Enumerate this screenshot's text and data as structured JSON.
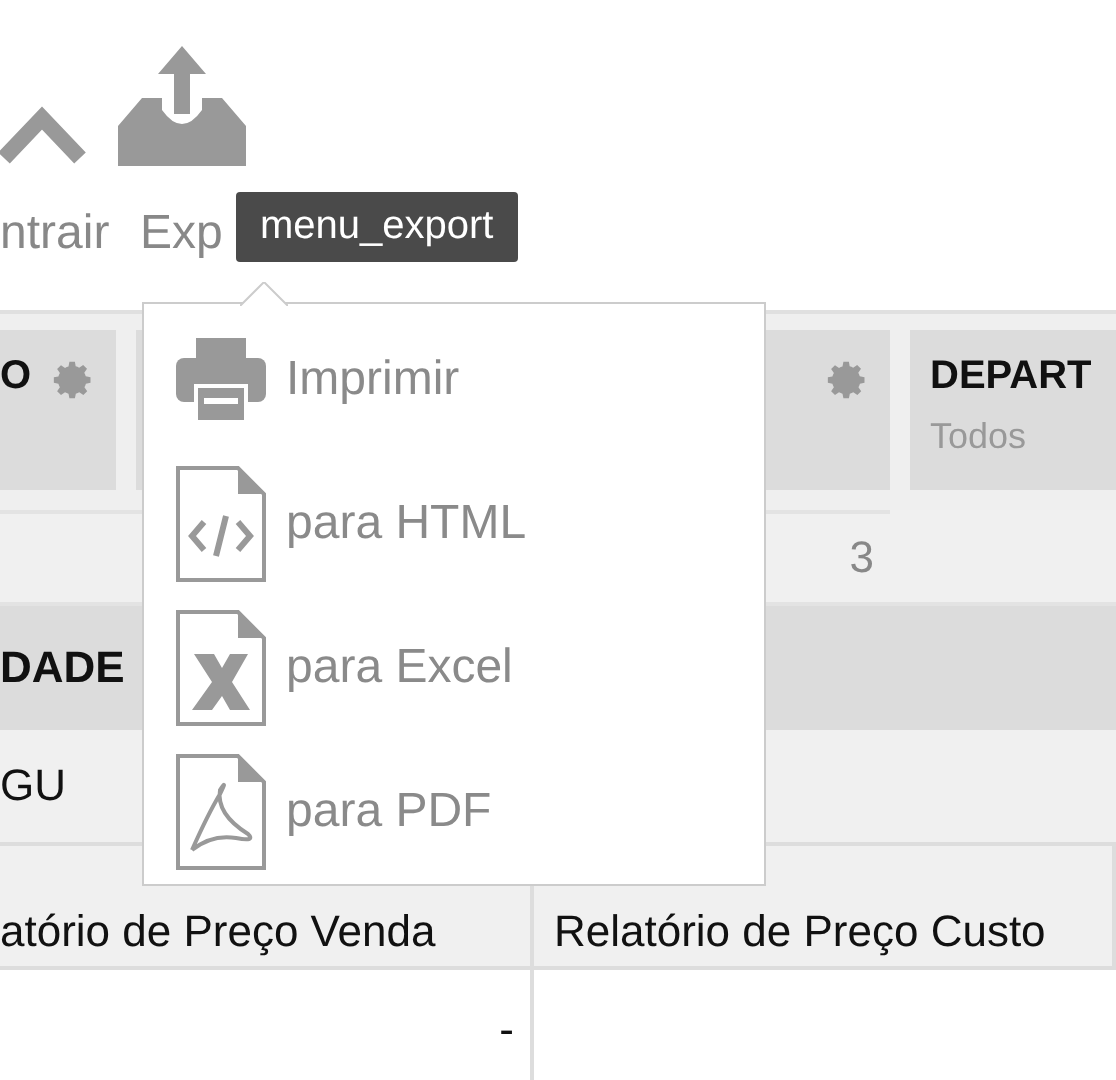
{
  "toolbar": [
    {
      "label": "ntrair",
      "kind": "chevron"
    },
    {
      "label": "Exp",
      "kind": "export"
    }
  ],
  "tooltip": "menu_export",
  "export_menu": [
    {
      "label": "Imprimir",
      "kind": "printer"
    },
    {
      "label": "para HTML",
      "kind": "html"
    },
    {
      "label": "para Excel",
      "kind": "excel"
    },
    {
      "label": "para PDF",
      "kind": "pdf"
    }
  ],
  "filters": [
    {
      "label": "O",
      "kind": "settings"
    },
    {
      "kind": "settings"
    },
    {
      "label": "DEPART",
      "value": "Todos",
      "kind": "text"
    }
  ],
  "count": "3",
  "group_header": "DADE",
  "group_value": "GU",
  "columns": [
    "atório de Preço Venda",
    "Relatório de Preço Custo"
  ],
  "rows": [
    [
      "-"
    ]
  ]
}
